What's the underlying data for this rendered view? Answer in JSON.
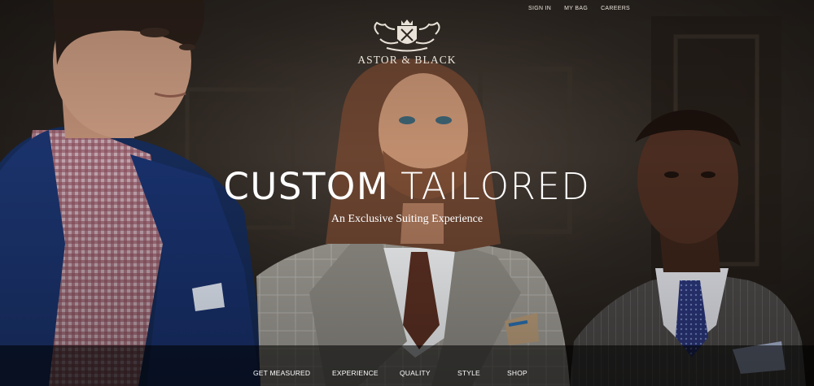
{
  "top_nav": {
    "items": [
      "SIGN IN",
      "MY BAG",
      "CAREERS"
    ]
  },
  "brand": {
    "name": "ASTOR & BLACK",
    "crest_icon": "heraldic-crest-icon"
  },
  "hero": {
    "headline_word1": "CUSTOM",
    "headline_word2": "TAILORED",
    "subheadline": "An Exclusive Suiting Experience"
  },
  "main_nav": {
    "items": [
      "GET MEASURED",
      "EXPERIENCE",
      "QUALITY",
      "STYLE",
      "SHOP"
    ]
  },
  "colors": {
    "nav_bar_bg": "rgba(0,0,0,0.58)",
    "text": "#ffffff"
  }
}
